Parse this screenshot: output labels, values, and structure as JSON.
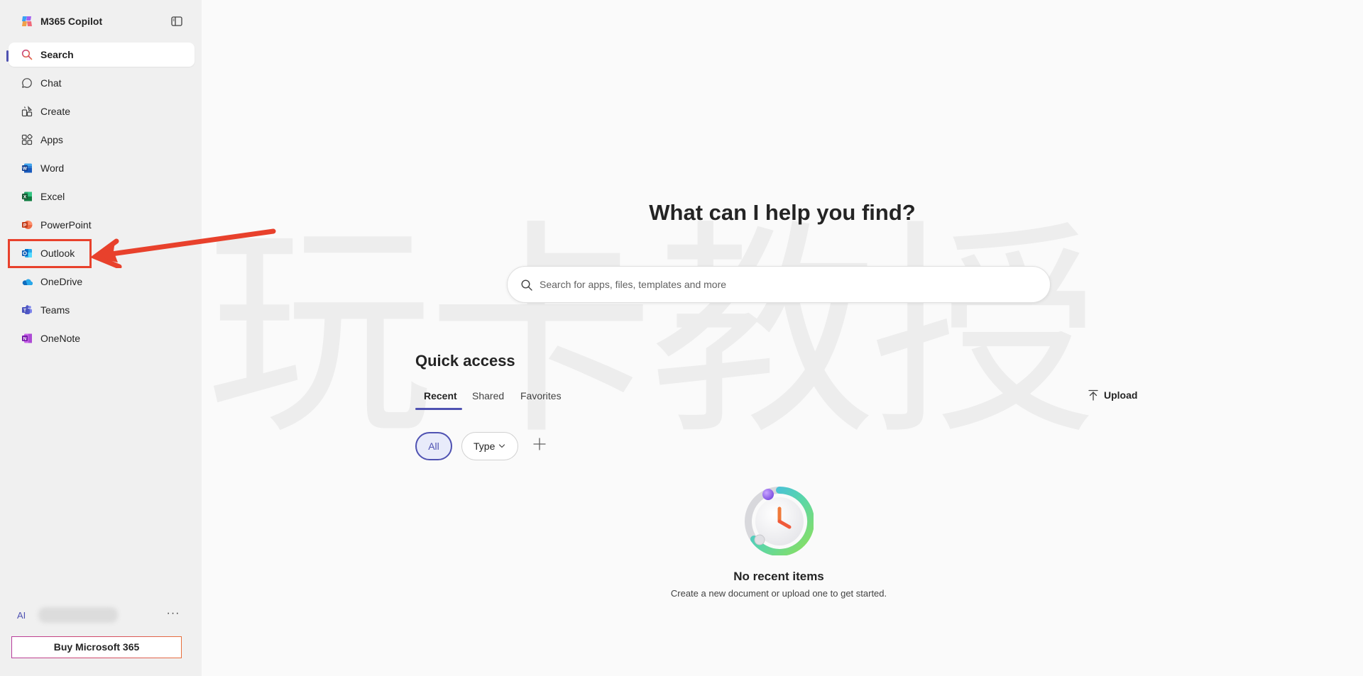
{
  "app": {
    "title": "M365 Copilot"
  },
  "sidebar": {
    "items": [
      {
        "label": "Search",
        "icon": "search-icon",
        "active": true
      },
      {
        "label": "Chat",
        "icon": "chat-icon"
      },
      {
        "label": "Create",
        "icon": "create-icon"
      },
      {
        "label": "Apps",
        "icon": "apps-icon"
      },
      {
        "label": "Word",
        "icon": "word-icon"
      },
      {
        "label": "Excel",
        "icon": "excel-icon"
      },
      {
        "label": "PowerPoint",
        "icon": "powerpoint-icon"
      },
      {
        "label": "Outlook",
        "icon": "outlook-icon",
        "highlighted": true
      },
      {
        "label": "OneDrive",
        "icon": "onedrive-icon"
      },
      {
        "label": "Teams",
        "icon": "teams-icon"
      },
      {
        "label": "OneNote",
        "icon": "onenote-icon"
      }
    ],
    "footer": {
      "user_initials": "AI",
      "more_label": "···",
      "buy_label": "Buy Microsoft 365"
    }
  },
  "main": {
    "hero_title": "What can I help you find?",
    "search": {
      "placeholder": "Search for apps, files, templates and more"
    },
    "quick_access": {
      "title": "Quick access",
      "tabs": [
        {
          "label": "Recent",
          "active": true
        },
        {
          "label": "Shared"
        },
        {
          "label": "Favorites"
        }
      ],
      "upload_label": "Upload",
      "filters": {
        "all": "All",
        "type": "Type"
      }
    },
    "empty_state": {
      "title": "No recent items",
      "subtitle": "Create a new document or upload one to get started."
    }
  },
  "watermark": {
    "text": "玩卡教授"
  },
  "colors": {
    "accent": "#4f52b2",
    "annotation": "#e8412c",
    "sidebar_bg": "#f0f0f0",
    "page_bg": "#fafafa"
  }
}
